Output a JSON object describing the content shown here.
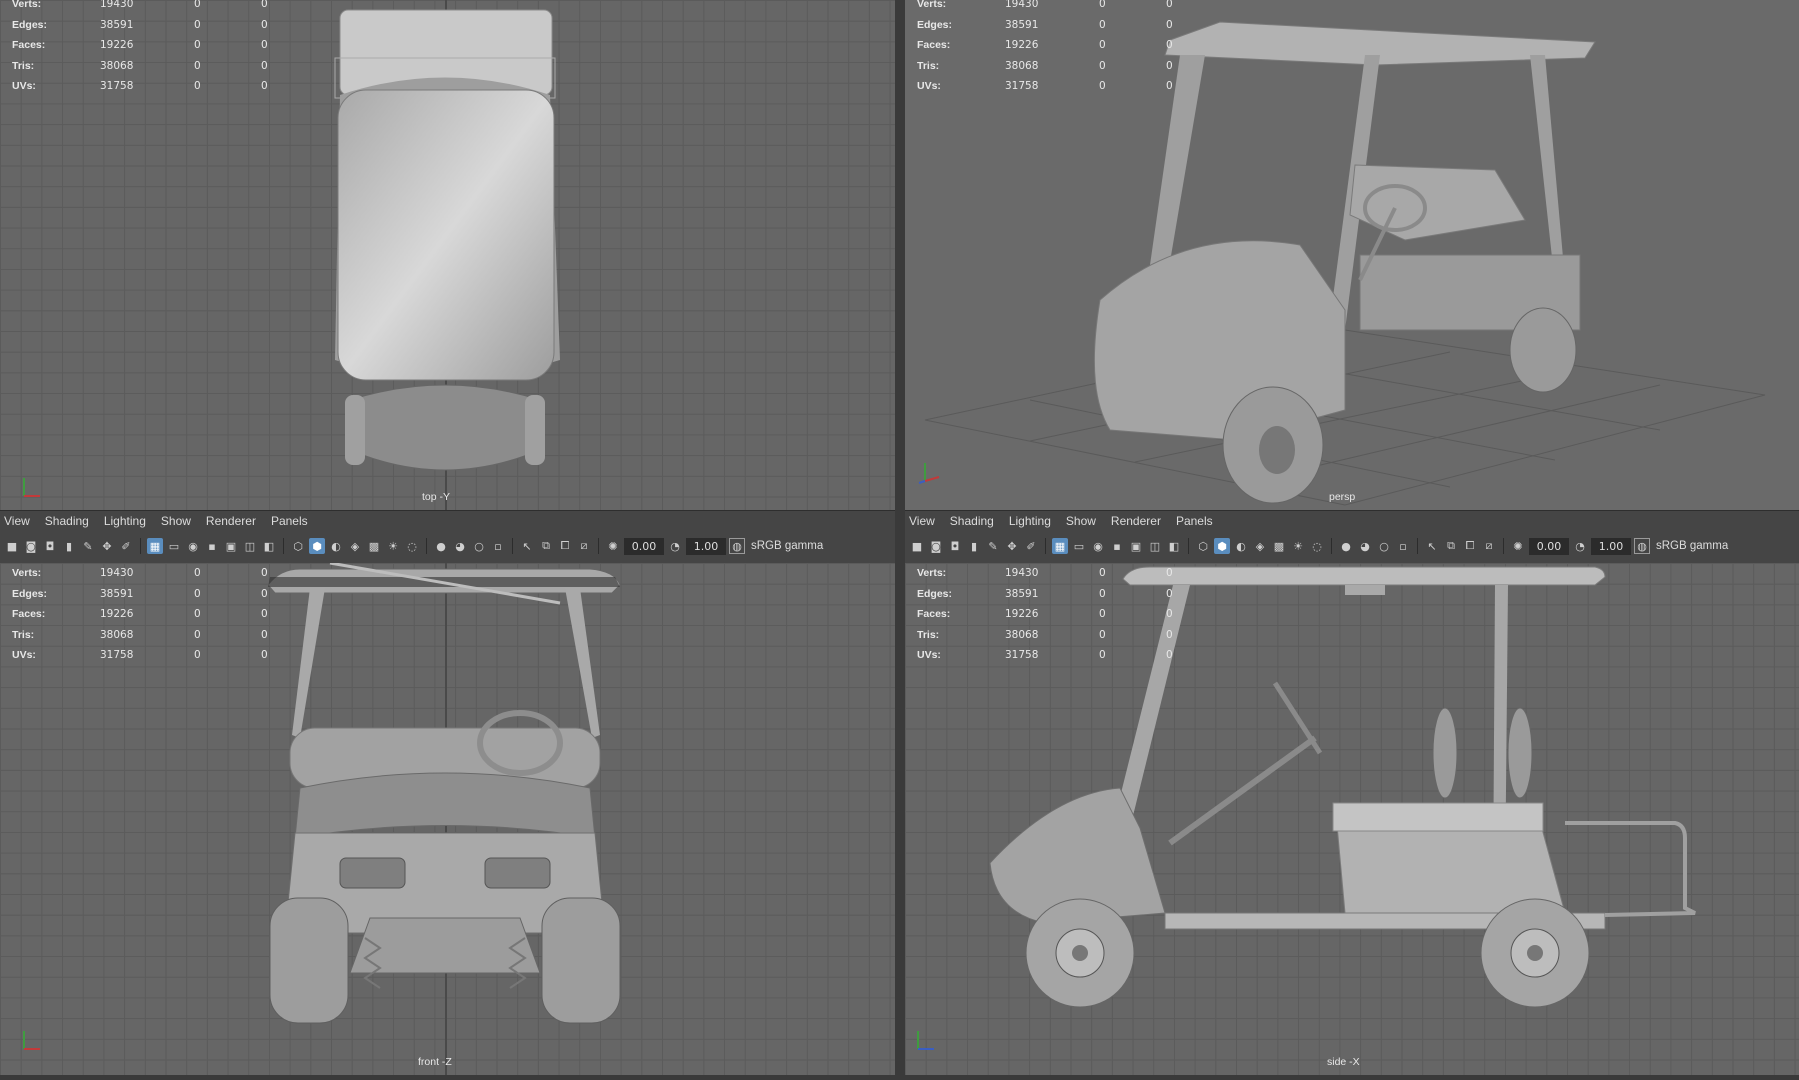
{
  "hud": {
    "rows": [
      {
        "label": "Verts:",
        "v1": "19430",
        "v2": "0",
        "v3": "0"
      },
      {
        "label": "Edges:",
        "v1": "38591",
        "v2": "0",
        "v3": "0"
      },
      {
        "label": "Faces:",
        "v1": "19226",
        "v2": "0",
        "v3": "0"
      },
      {
        "label": "Tris:",
        "v1": "38068",
        "v2": "0",
        "v3": "0"
      },
      {
        "label": "UVs:",
        "v1": "31758",
        "v2": "0",
        "v3": "0"
      }
    ]
  },
  "viewports": {
    "top": {
      "camera": "top -Y"
    },
    "persp": {
      "camera": "persp"
    },
    "front": {
      "camera": "front -Z"
    },
    "side": {
      "camera": "side -X"
    }
  },
  "panel_menu": {
    "view": "View",
    "shading": "Shading",
    "lighting": "Lighting",
    "show": "Show",
    "renderer": "Renderer",
    "panels": "Panels"
  },
  "panel_toolbar": {
    "exposure": "0.00",
    "gamma": "1.00",
    "color_space": "sRGB gamma"
  },
  "colors": {
    "viewport_bg": "#666666",
    "grid_line": "#5b5b5b",
    "active_icon": "#5a8dbe",
    "panel_bg": "#454545"
  }
}
